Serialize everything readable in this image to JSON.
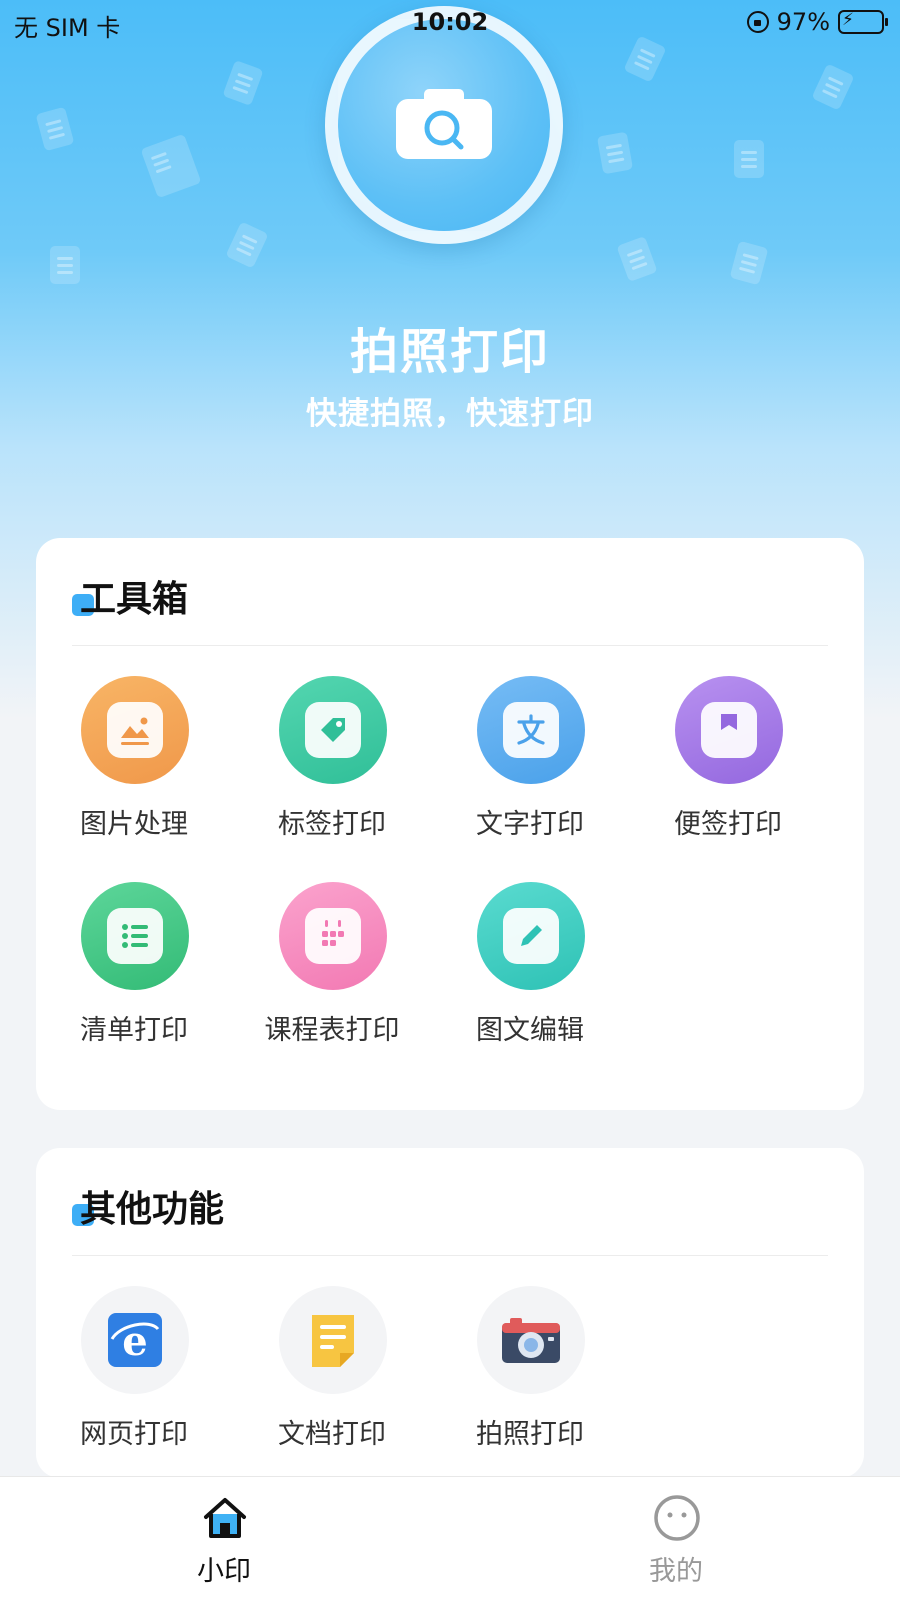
{
  "status_bar": {
    "carrier": "无 SIM 卡",
    "time": "10:02",
    "battery": "97%"
  },
  "hero": {
    "title": "拍照打印",
    "subtitle": "快捷拍照，快速打印",
    "icon": "camera-search-icon"
  },
  "toolbox": {
    "title": "工具箱",
    "items": [
      {
        "label": "图片处理",
        "icon": "image-icon",
        "color": "#f3a34f"
      },
      {
        "label": "标签打印",
        "icon": "tag-icon",
        "color": "#3fc9a4"
      },
      {
        "label": "文字打印",
        "icon": "text-icon",
        "color": "#5aaef0"
      },
      {
        "label": "便签打印",
        "icon": "bookmark-icon",
        "color": "#a57ae6"
      },
      {
        "label": "清单打印",
        "icon": "list-icon",
        "color": "#3fc683"
      },
      {
        "label": "课程表打印",
        "icon": "calendar-icon",
        "color": "#f68cc0"
      },
      {
        "label": "图文编辑",
        "icon": "edit-icon",
        "color": "#3ecfc2"
      }
    ]
  },
  "other": {
    "title": "其他功能",
    "items": [
      {
        "label": "网页打印",
        "icon": "browser-icon",
        "color": "#2f7fe3"
      },
      {
        "label": "文档打印",
        "icon": "document-icon",
        "color": "#f7c541"
      },
      {
        "label": "拍照打印",
        "icon": "camera-icon",
        "color": "#e05b5b"
      }
    ]
  },
  "tabbar": {
    "tabs": [
      {
        "label": "小印",
        "icon": "home-icon",
        "active": true
      },
      {
        "label": "我的",
        "icon": "profile-icon",
        "active": false
      }
    ],
    "active_color": "#111111",
    "inactive_color": "#999999"
  }
}
